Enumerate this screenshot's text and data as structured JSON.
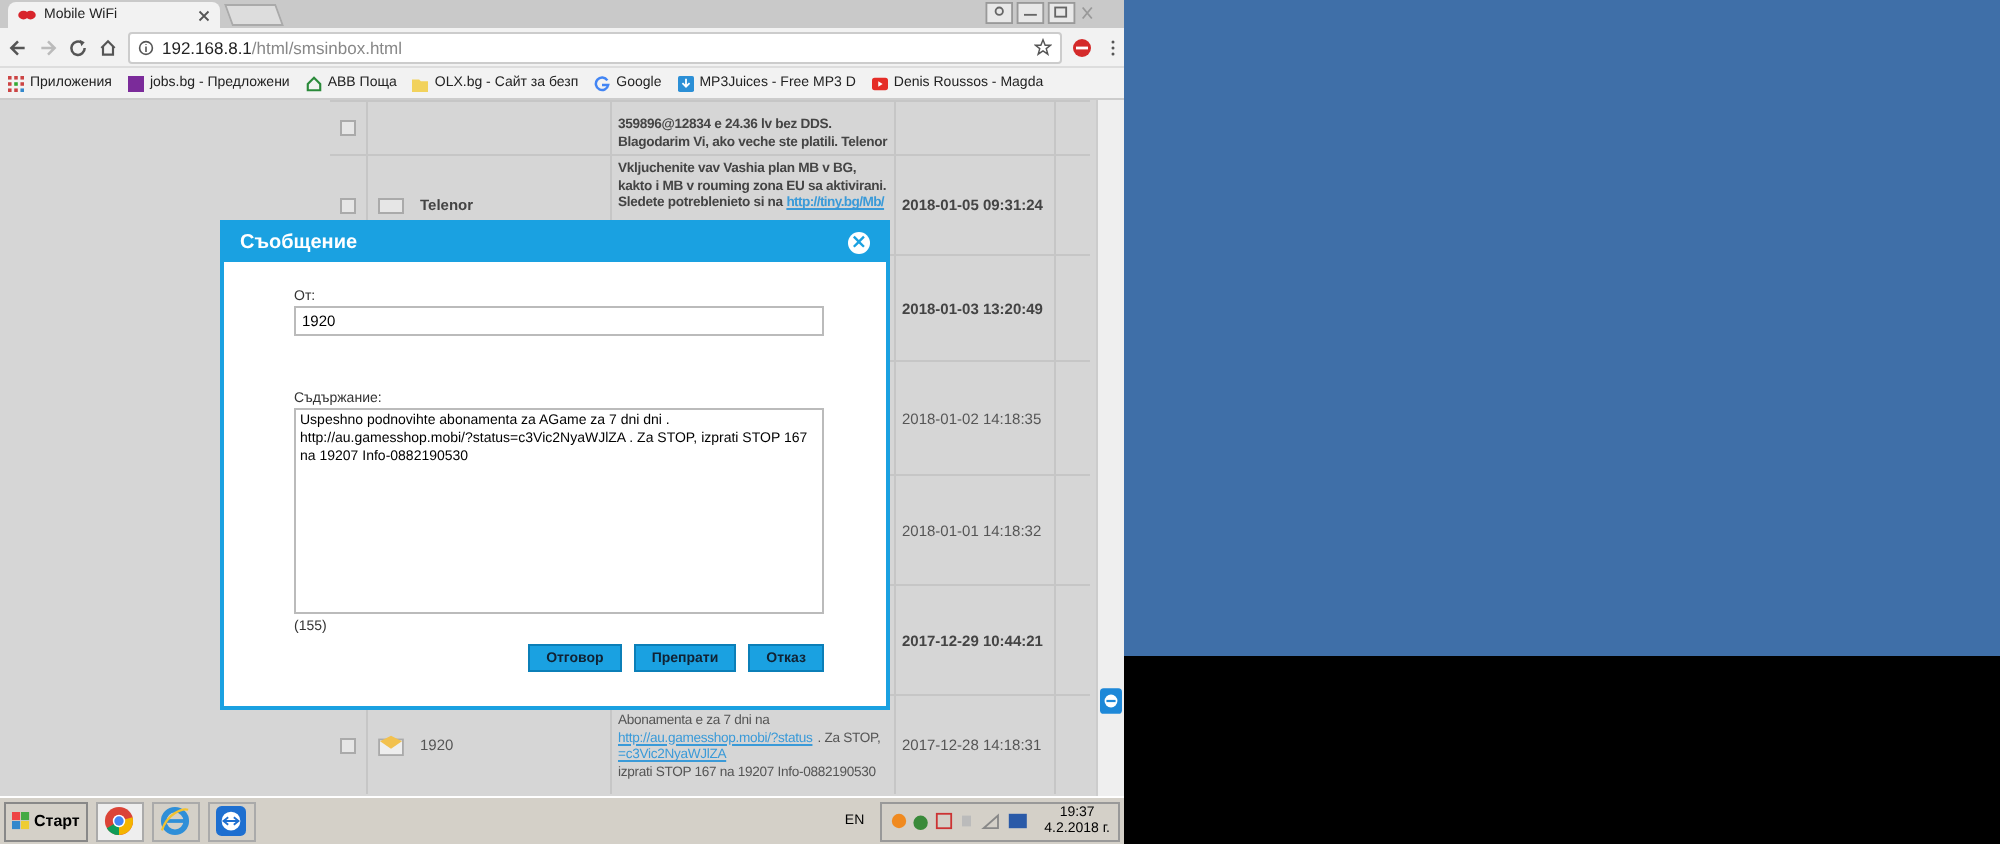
{
  "browser": {
    "tab_title": "Mobile WiFi",
    "url_host": "192.168.8.1",
    "url_path": "/html/smsinbox.html"
  },
  "bookmarks": [
    {
      "label": "Приложения",
      "kind": "apps"
    },
    {
      "label": "jobs.bg - Предложени",
      "kind": "square"
    },
    {
      "label": "ABB Поща",
      "kind": "house"
    },
    {
      "label": "OLX.bg - Сайт за безп",
      "kind": "folder"
    },
    {
      "label": "Google",
      "kind": "google"
    },
    {
      "label": "MP3Juices - Free MP3 D",
      "kind": "download"
    },
    {
      "label": "Denis Roussos - Magda",
      "kind": "video"
    }
  ],
  "messages": [
    {
      "message": "359896@12834 e 24.36 lv bez DDS. Blagodarim Vi, ako veche ste platili. Telenor",
      "unread": true,
      "checked": false
    },
    {
      "name": "Telenor",
      "icon": false,
      "checked": false,
      "message": "Vkljuchenite vav Vashia plan MB v BG, kakto i MB v rouming zona EU sa aktivirani. Sledete potreblenieto si na ",
      "link": "http://tiny.bg/Mb/",
      "date": "2018-01-05 09:31:24",
      "unread": true
    },
    {
      "date": "2018-01-03 13:20:49",
      "unread": true
    },
    {
      "date": "2018-01-02 14:18:35",
      "unread": false
    },
    {
      "date": "2018-01-01 14:18:32",
      "unread": false
    },
    {
      "date": "2017-12-29 10:44:21",
      "unread": true
    },
    {
      "name": "1920",
      "icon": true,
      "checked": false,
      "message": "Abonamenta e za 7 dni na ",
      "link": "http://au.gamesshop.mobi/?status=c3Vic2NyaWJlZA",
      "message_after": " . Za STOP, izprati STOP 167 na 19207 Info-0882190530",
      "date": "2017-12-28 14:18:31",
      "unread": false
    }
  ],
  "dialog": {
    "title": "Съобщение",
    "close": "×",
    "from_label": "От:",
    "from_value": "1920",
    "content_label": "Съдържание:",
    "content_value": "Uspeshno podnovihte abonamenta za AGame za 7 dni dni . http://au.gamesshop.mobi/?status=c3Vic2NyaWJlZA . Za STOP, izprati STOP 167 na 19207 Info-0882190530",
    "count": "(155)",
    "buttons": [
      "Отговор",
      "Препрати",
      "Отказ"
    ]
  },
  "taskbar": {
    "start": "Старт",
    "language": "EN",
    "time": "19:37",
    "date": "4.2.2018 г."
  }
}
